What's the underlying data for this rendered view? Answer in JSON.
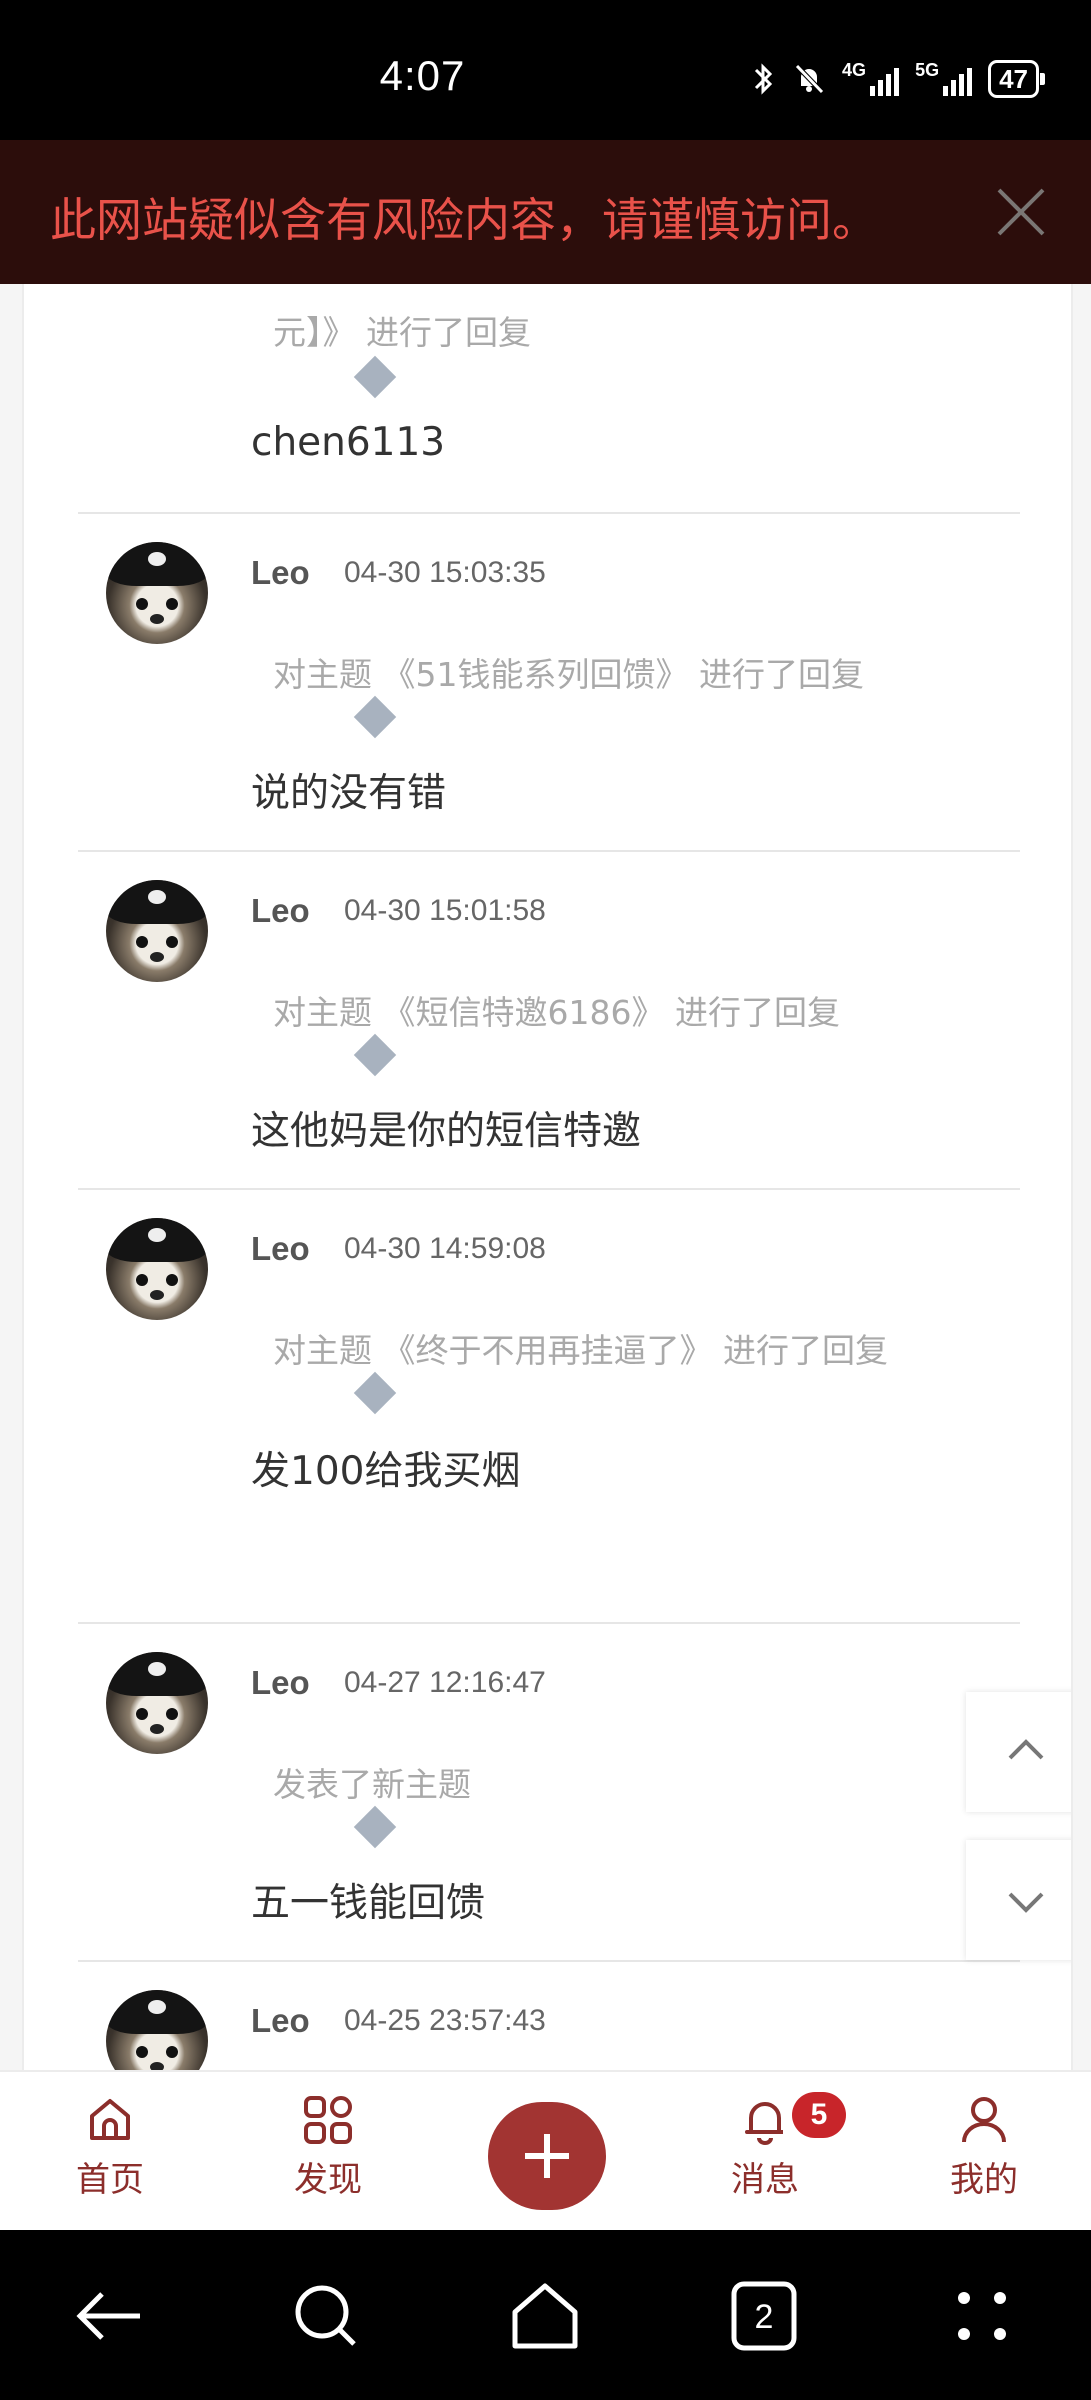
{
  "status_bar": {
    "time": "4:07",
    "network_1": "4G",
    "network_2": "5G",
    "battery": "47"
  },
  "warning_banner": {
    "text": "此网站疑似含有风险内容，请谨慎访问。"
  },
  "feed": {
    "partial_top": {
      "action": "元】》 进行了回复",
      "message": "chen6113"
    },
    "items": [
      {
        "name": "Leo",
        "time": "04-30 15:03:35",
        "action": "对主题 《51钱能系列回馈》 进行了回复",
        "message": "说的没有错"
      },
      {
        "name": "Leo",
        "time": "04-30 15:01:58",
        "action": "对主题 《短信特邀6186》 进行了回复",
        "message": "这他妈是你的短信特邀"
      },
      {
        "name": "Leo",
        "time": "04-30 14:59:08",
        "action": "对主题 《终于不用再挂逼了》 进行了回复",
        "message": "发100给我买烟"
      },
      {
        "name": "Leo",
        "time": "04-27 12:16:47",
        "action": "发表了新主题",
        "message": "五一钱能回馈"
      },
      {
        "name": "Leo",
        "time": "04-25 23:57:43"
      }
    ]
  },
  "bottom_nav": {
    "home": "首页",
    "discover": "发现",
    "messages": "消息",
    "messages_badge": "5",
    "mine": "我的"
  },
  "colors": {
    "accent": "#a23432",
    "warning_text": "#e9524a",
    "warning_bg": "#2c0d0b"
  }
}
